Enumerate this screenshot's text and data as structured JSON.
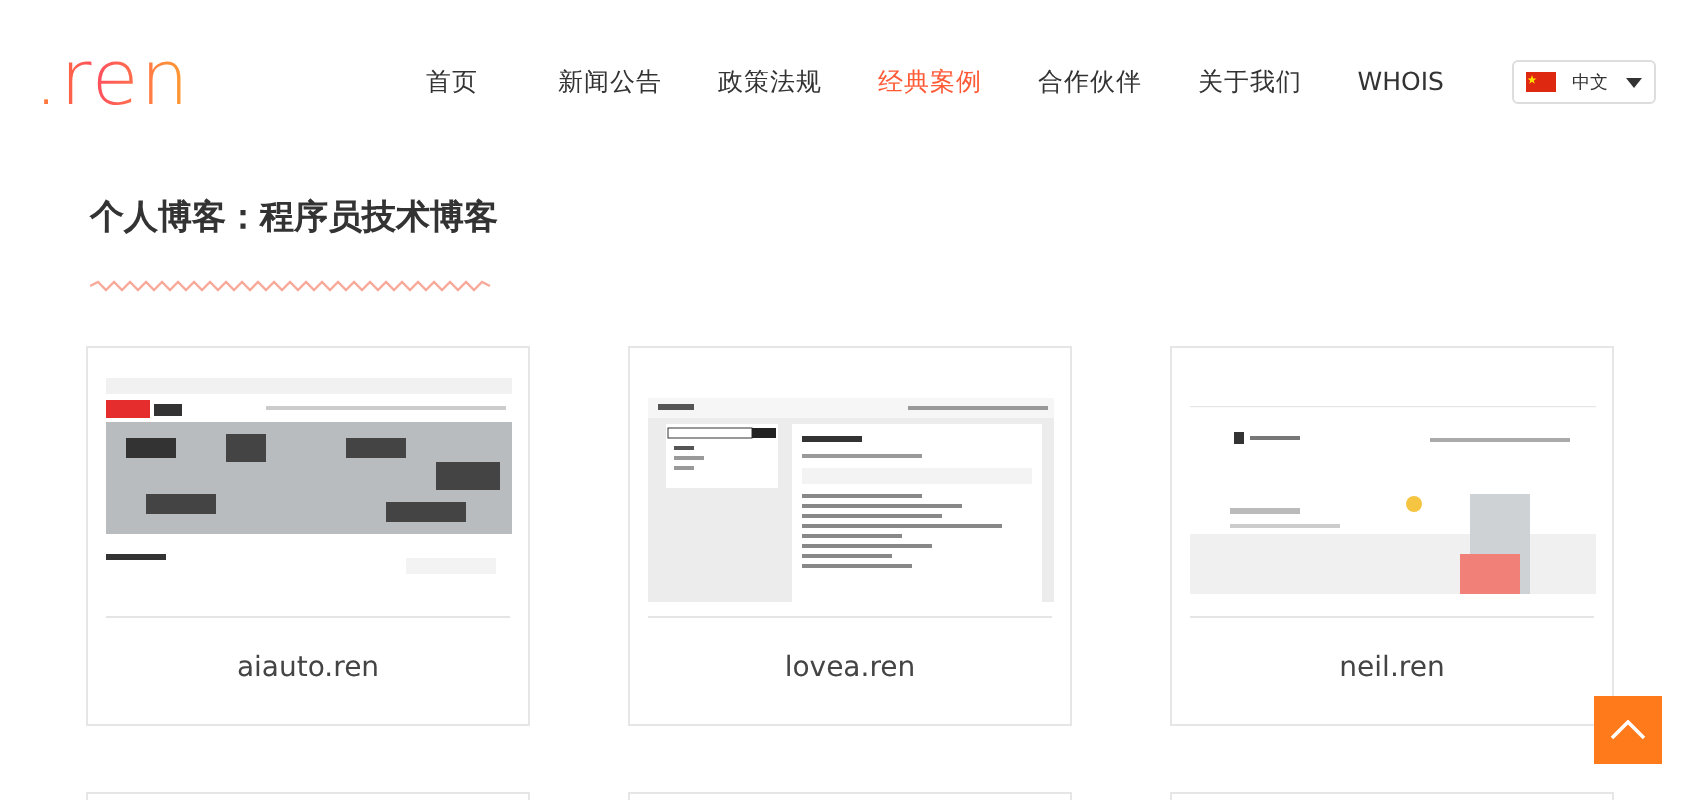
{
  "header": {
    "logo": ".ren",
    "nav": [
      {
        "label": "首页",
        "selected": false
      },
      {
        "label": "新闻公告",
        "selected": false
      },
      {
        "label": "政策法规",
        "selected": false
      },
      {
        "label": "经典案例",
        "selected": true
      },
      {
        "label": "合作伙伴",
        "selected": false
      },
      {
        "label": "关于我们",
        "selected": false
      },
      {
        "label": "WHOIS",
        "selected": false
      }
    ],
    "language": {
      "label": "中文"
    }
  },
  "title": "个人博客：程序员技术博客",
  "cases": [
    {
      "label": "aiauto.ren",
      "kind": "automation"
    },
    {
      "label": "lovea.ren",
      "kind": "article"
    },
    {
      "label": "neil.ren",
      "kind": "portfolio"
    }
  ]
}
